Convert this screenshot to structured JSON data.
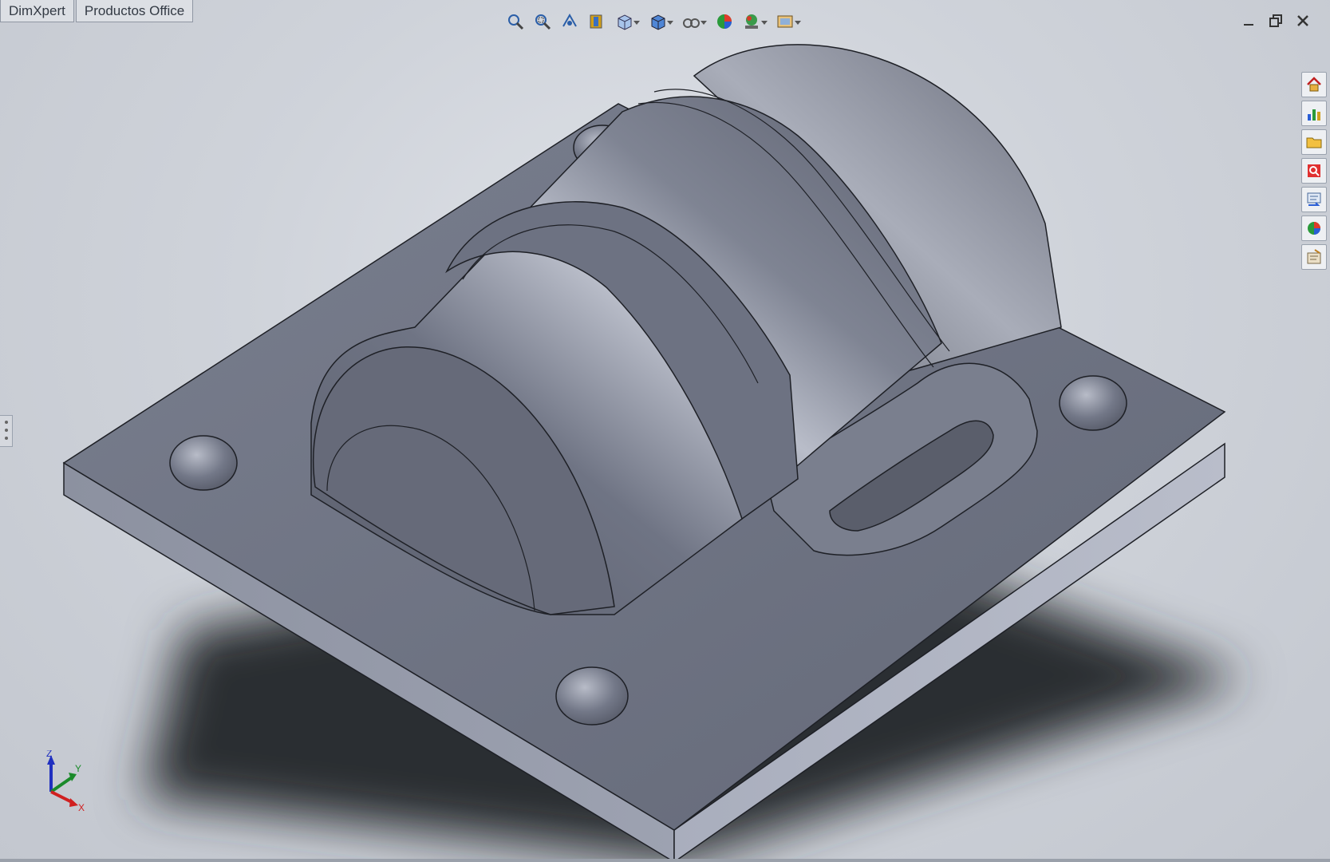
{
  "tabs": [
    "DimXpert",
    "Productos Office"
  ],
  "view_toolbar": {
    "icons": [
      "zoom-to-fit-icon",
      "zoom-to-area-icon",
      "previous-view-icon",
      "section-view-icon",
      "view-orientation-icon",
      "display-style-icon",
      "hide-show-items-icon",
      "edit-appearance-icon",
      "apply-scene-icon",
      "view-settings-icon"
    ]
  },
  "window_controls": [
    "minimize-icon",
    "restore-icon",
    "close-icon"
  ],
  "task_pane": [
    "home-icon",
    "resources-icon",
    "open-folder-icon",
    "search-icon",
    "file-explorer-icon",
    "appearances-icon",
    "custom-properties-icon"
  ],
  "triad": {
    "x": "X",
    "y": "Y",
    "z": "Z"
  },
  "colors": {
    "part_face": "#6b7080",
    "part_light": "#9ea3b3",
    "part_dark": "#4d5160",
    "edge": "#1e2026",
    "shadow": "#2b2d33",
    "axis_x": "#d02020",
    "axis_y": "#1a8a2a",
    "axis_z": "#2030c0"
  }
}
